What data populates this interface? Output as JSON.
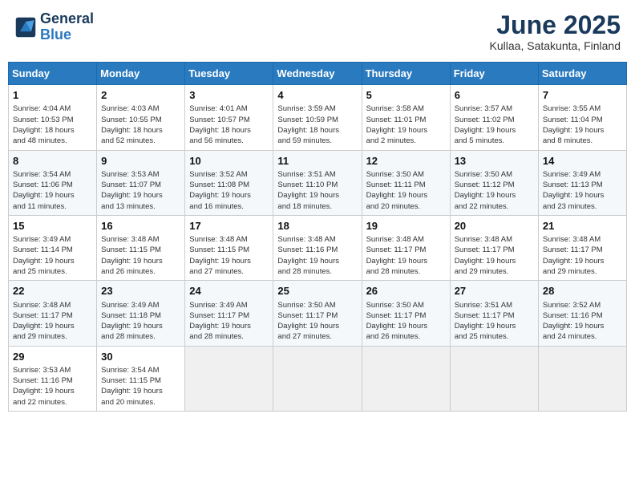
{
  "header": {
    "logo_line1": "General",
    "logo_line2": "Blue",
    "title": "June 2025",
    "subtitle": "Kullaa, Satakunta, Finland"
  },
  "days_of_week": [
    "Sunday",
    "Monday",
    "Tuesday",
    "Wednesday",
    "Thursday",
    "Friday",
    "Saturday"
  ],
  "weeks": [
    [
      {
        "day": "1",
        "info": "Sunrise: 4:04 AM\nSunset: 10:53 PM\nDaylight: 18 hours\nand 48 minutes."
      },
      {
        "day": "2",
        "info": "Sunrise: 4:03 AM\nSunset: 10:55 PM\nDaylight: 18 hours\nand 52 minutes."
      },
      {
        "day": "3",
        "info": "Sunrise: 4:01 AM\nSunset: 10:57 PM\nDaylight: 18 hours\nand 56 minutes."
      },
      {
        "day": "4",
        "info": "Sunrise: 3:59 AM\nSunset: 10:59 PM\nDaylight: 18 hours\nand 59 minutes."
      },
      {
        "day": "5",
        "info": "Sunrise: 3:58 AM\nSunset: 11:01 PM\nDaylight: 19 hours\nand 2 minutes."
      },
      {
        "day": "6",
        "info": "Sunrise: 3:57 AM\nSunset: 11:02 PM\nDaylight: 19 hours\nand 5 minutes."
      },
      {
        "day": "7",
        "info": "Sunrise: 3:55 AM\nSunset: 11:04 PM\nDaylight: 19 hours\nand 8 minutes."
      }
    ],
    [
      {
        "day": "8",
        "info": "Sunrise: 3:54 AM\nSunset: 11:06 PM\nDaylight: 19 hours\nand 11 minutes."
      },
      {
        "day": "9",
        "info": "Sunrise: 3:53 AM\nSunset: 11:07 PM\nDaylight: 19 hours\nand 13 minutes."
      },
      {
        "day": "10",
        "info": "Sunrise: 3:52 AM\nSunset: 11:08 PM\nDaylight: 19 hours\nand 16 minutes."
      },
      {
        "day": "11",
        "info": "Sunrise: 3:51 AM\nSunset: 11:10 PM\nDaylight: 19 hours\nand 18 minutes."
      },
      {
        "day": "12",
        "info": "Sunrise: 3:50 AM\nSunset: 11:11 PM\nDaylight: 19 hours\nand 20 minutes."
      },
      {
        "day": "13",
        "info": "Sunrise: 3:50 AM\nSunset: 11:12 PM\nDaylight: 19 hours\nand 22 minutes."
      },
      {
        "day": "14",
        "info": "Sunrise: 3:49 AM\nSunset: 11:13 PM\nDaylight: 19 hours\nand 23 minutes."
      }
    ],
    [
      {
        "day": "15",
        "info": "Sunrise: 3:49 AM\nSunset: 11:14 PM\nDaylight: 19 hours\nand 25 minutes."
      },
      {
        "day": "16",
        "info": "Sunrise: 3:48 AM\nSunset: 11:15 PM\nDaylight: 19 hours\nand 26 minutes."
      },
      {
        "day": "17",
        "info": "Sunrise: 3:48 AM\nSunset: 11:15 PM\nDaylight: 19 hours\nand 27 minutes."
      },
      {
        "day": "18",
        "info": "Sunrise: 3:48 AM\nSunset: 11:16 PM\nDaylight: 19 hours\nand 28 minutes."
      },
      {
        "day": "19",
        "info": "Sunrise: 3:48 AM\nSunset: 11:17 PM\nDaylight: 19 hours\nand 28 minutes."
      },
      {
        "day": "20",
        "info": "Sunrise: 3:48 AM\nSunset: 11:17 PM\nDaylight: 19 hours\nand 29 minutes."
      },
      {
        "day": "21",
        "info": "Sunrise: 3:48 AM\nSunset: 11:17 PM\nDaylight: 19 hours\nand 29 minutes."
      }
    ],
    [
      {
        "day": "22",
        "info": "Sunrise: 3:48 AM\nSunset: 11:17 PM\nDaylight: 19 hours\nand 29 minutes."
      },
      {
        "day": "23",
        "info": "Sunrise: 3:49 AM\nSunset: 11:18 PM\nDaylight: 19 hours\nand 28 minutes."
      },
      {
        "day": "24",
        "info": "Sunrise: 3:49 AM\nSunset: 11:17 PM\nDaylight: 19 hours\nand 28 minutes."
      },
      {
        "day": "25",
        "info": "Sunrise: 3:50 AM\nSunset: 11:17 PM\nDaylight: 19 hours\nand 27 minutes."
      },
      {
        "day": "26",
        "info": "Sunrise: 3:50 AM\nSunset: 11:17 PM\nDaylight: 19 hours\nand 26 minutes."
      },
      {
        "day": "27",
        "info": "Sunrise: 3:51 AM\nSunset: 11:17 PM\nDaylight: 19 hours\nand 25 minutes."
      },
      {
        "day": "28",
        "info": "Sunrise: 3:52 AM\nSunset: 11:16 PM\nDaylight: 19 hours\nand 24 minutes."
      }
    ],
    [
      {
        "day": "29",
        "info": "Sunrise: 3:53 AM\nSunset: 11:16 PM\nDaylight: 19 hours\nand 22 minutes."
      },
      {
        "day": "30",
        "info": "Sunrise: 3:54 AM\nSunset: 11:15 PM\nDaylight: 19 hours\nand 20 minutes."
      },
      {
        "day": "",
        "info": ""
      },
      {
        "day": "",
        "info": ""
      },
      {
        "day": "",
        "info": ""
      },
      {
        "day": "",
        "info": ""
      },
      {
        "day": "",
        "info": ""
      }
    ]
  ]
}
